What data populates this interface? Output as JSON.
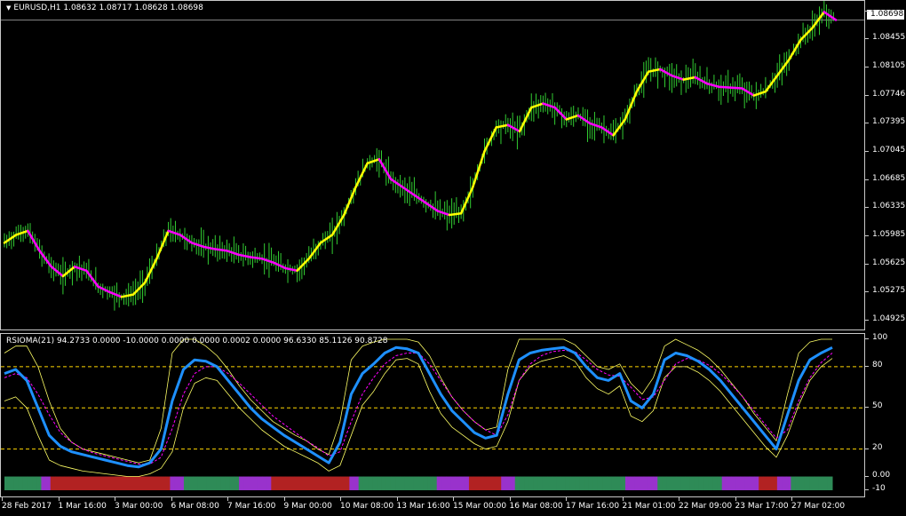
{
  "price_chart": {
    "symbol_line": "EURUSD,H1  1.08632 1.08717 1.08628 1.08698",
    "current_price": "1.08698",
    "y_labels": [
      "1.08805",
      "1.08455",
      "1.08105",
      "1.07746",
      "1.07395",
      "1.07045",
      "1.06685",
      "1.06335",
      "1.05985",
      "1.05625",
      "1.05275",
      "1.04925"
    ],
    "colors": {
      "bars": "#32cd32",
      "ma_up": "#ffff00",
      "ma_down": "#ff00ff",
      "grid": "#c8c8c8"
    }
  },
  "indicator": {
    "title_line": "RSIOMA(21) 94.2733 0.0000 -10.0000 0.0000 0.0000 0.0002 0.0000 96.6330 85.1126 90.8728",
    "y_labels": [
      "100",
      "80",
      "50",
      "20",
      "0.00",
      "-10"
    ],
    "levels": [
      80,
      50,
      20
    ],
    "colors": {
      "rsioma": "#1e90ff",
      "signal": "#ff00ff",
      "bands": "#ffff66",
      "level": "#ffd700",
      "hist_up": "#2e8b57",
      "hist_down": "#b22222"
    }
  },
  "time_axis": {
    "labels": [
      "28 Feb 2017",
      "1 Mar 16:00",
      "3 Mar 00:00",
      "6 Mar 08:00",
      "7 Mar 16:00",
      "9 Mar 00:00",
      "10 Mar 08:00",
      "13 Mar 16:00",
      "15 Mar 00:00",
      "16 Mar 08:00",
      "17 Mar 16:00",
      "21 Mar 01:00",
      "22 Mar 09:00",
      "23 Mar 17:00",
      "27 Mar 02:00"
    ]
  },
  "chart_data": [
    {
      "type": "line",
      "title": "EURUSD,H1",
      "ylim": [
        1.049,
        1.0885
      ],
      "series": [
        {
          "values": [
            1.059,
            1.06,
            1.0605,
            1.058,
            1.056,
            1.0548,
            1.056,
            1.0555,
            1.0535,
            1.0528,
            1.0522,
            1.0525,
            1.054,
            1.057,
            1.0605,
            1.06,
            1.059,
            1.0585,
            1.0582,
            1.058,
            1.0575,
            1.0572,
            1.057,
            1.0565,
            1.0558,
            1.0555,
            1.057,
            1.059,
            1.06,
            1.0625,
            1.066,
            1.069,
            1.0695,
            1.067,
            1.066,
            1.065,
            1.064,
            1.063,
            1.0625,
            1.0627,
            1.066,
            1.0705,
            1.0735,
            1.0738,
            1.073,
            1.076,
            1.0765,
            1.076,
            1.0745,
            1.075,
            1.074,
            1.0735,
            1.0725,
            1.0745,
            1.078,
            1.0805,
            1.0808,
            1.08,
            1.0795,
            1.0798,
            1.079,
            1.0786,
            1.0785,
            1.0784,
            1.0775,
            1.078,
            1.08,
            1.082,
            1.0845,
            1.086,
            1.088,
            1.087
          ]
        }
      ]
    },
    {
      "type": "line",
      "title": "RSIOMA(21)",
      "ylim": [
        -10,
        100
      ],
      "series": [
        {
          "values": [
            75,
            78,
            70,
            50,
            30,
            22,
            18,
            16,
            14,
            12,
            10,
            8,
            7,
            10,
            20,
            55,
            78,
            85,
            84,
            80,
            70,
            60,
            50,
            42,
            36,
            30,
            25,
            20,
            15,
            10,
            25,
            60,
            75,
            82,
            90,
            94,
            93,
            90,
            75,
            60,
            48,
            40,
            32,
            28,
            30,
            60,
            85,
            90,
            92,
            93,
            94,
            90,
            80,
            72,
            70,
            75,
            55,
            50,
            60,
            85,
            90,
            88,
            84,
            78,
            70,
            60,
            50,
            40,
            30,
            20,
            45,
            70,
            85,
            90,
            94
          ]
        },
        {
          "values": [
            72,
            75,
            72,
            60,
            45,
            32,
            25,
            20,
            17,
            15,
            13,
            11,
            9,
            9,
            14,
            35,
            60,
            75,
            80,
            80,
            75,
            68,
            60,
            52,
            44,
            38,
            32,
            26,
            21,
            15,
            18,
            40,
            60,
            72,
            82,
            88,
            90,
            90,
            82,
            70,
            58,
            48,
            40,
            34,
            30,
            45,
            70,
            82,
            88,
            91,
            92,
            91,
            85,
            78,
            74,
            73,
            65,
            56,
            58,
            70,
            82,
            86,
            85,
            81,
            75,
            67,
            58,
            48,
            38,
            28,
            34,
            55,
            72,
            83,
            90
          ]
        },
        {
          "values": [
            90,
            95,
            95,
            80,
            55,
            35,
            25,
            20,
            18,
            16,
            14,
            12,
            10,
            12,
            35,
            90,
            100,
            100,
            95,
            88,
            78,
            66,
            56,
            48,
            40,
            35,
            30,
            26,
            20,
            16,
            40,
            85,
            95,
            98,
            100,
            100,
            100,
            98,
            88,
            72,
            58,
            48,
            40,
            34,
            36,
            78,
            100,
            100,
            100,
            100,
            100,
            96,
            88,
            80,
            78,
            82,
            68,
            60,
            72,
            95,
            100,
            96,
            92,
            86,
            78,
            68,
            58,
            46,
            36,
            26,
            60,
            90,
            98,
            100,
            100
          ]
        },
        {
          "values": [
            55,
            58,
            50,
            30,
            12,
            8,
            6,
            4,
            3,
            2,
            1,
            0,
            0,
            2,
            6,
            18,
            50,
            68,
            72,
            70,
            60,
            50,
            42,
            34,
            28,
            22,
            18,
            14,
            10,
            4,
            8,
            30,
            52,
            62,
            75,
            85,
            86,
            82,
            62,
            46,
            36,
            30,
            24,
            20,
            22,
            40,
            70,
            80,
            84,
            86,
            88,
            84,
            72,
            64,
            60,
            66,
            44,
            40,
            48,
            72,
            80,
            80,
            76,
            70,
            62,
            52,
            42,
            32,
            22,
            14,
            30,
            52,
            70,
            80,
            86
          ]
        }
      ]
    }
  ]
}
